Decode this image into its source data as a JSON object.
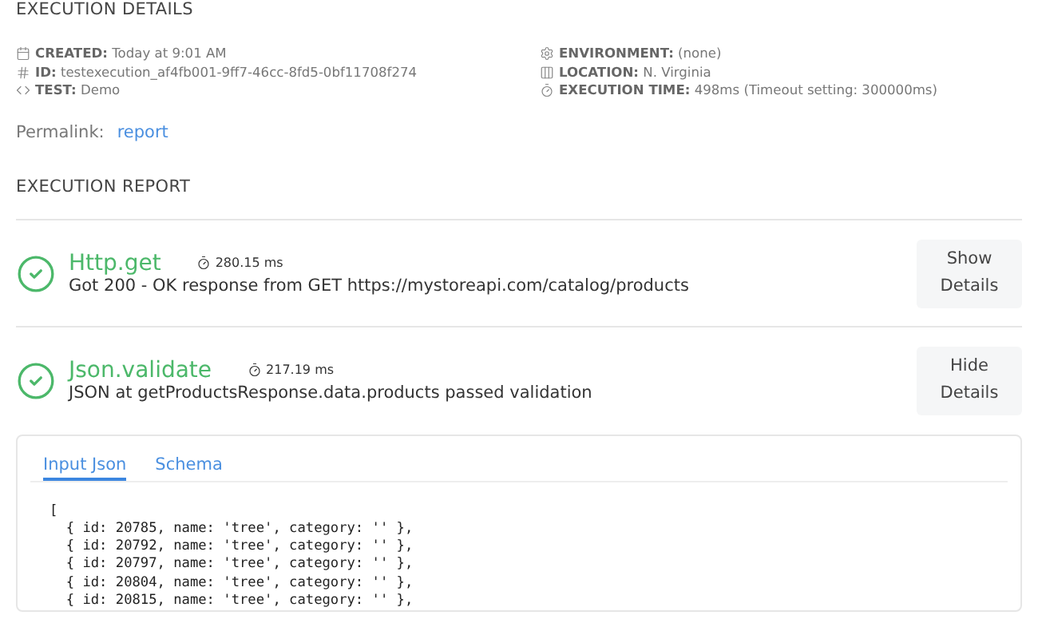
{
  "details": {
    "heading": "EXECUTION DETAILS",
    "left": [
      {
        "kind": "calendar",
        "label": "CREATED:",
        "value": "Today at 9:01 AM"
      },
      {
        "kind": "hash",
        "label": "ID:",
        "value": "testexecution_af4fb001-9ff7-46cc-8fd5-0bf11708f274"
      },
      {
        "kind": "code",
        "label": "TEST:",
        "value": "Demo"
      }
    ],
    "right": [
      {
        "kind": "gear",
        "label": "ENVIRONMENT:",
        "value": "(none)"
      },
      {
        "kind": "columns",
        "label": "LOCATION:",
        "value": "N. Virginia"
      },
      {
        "kind": "timer",
        "label": "EXECUTION TIME:",
        "value": "498ms (Timeout setting: 300000ms)"
      }
    ],
    "permalink_label": "Permalink:",
    "permalink": "report"
  },
  "report": {
    "heading": "EXECUTION REPORT",
    "steps": [
      {
        "name": "Http.get",
        "duration": "280.15 ms",
        "message": "Got 200 - OK response from GET https://mystoreapi.com/catalog/products",
        "button": [
          "Show",
          "Details"
        ]
      },
      {
        "name": "Json.validate",
        "duration": "217.19 ms",
        "message": "JSON at getProductsResponse.data.products passed validation",
        "button": [
          "Hide",
          "Details"
        ],
        "tabs": [
          {
            "label": "Input Json",
            "selected": true
          },
          {
            "label": "Schema",
            "selected": false
          }
        ],
        "code": [
          "[",
          "  { id: 20785, name: 'tree', category: '' },",
          "  { id: 20792, name: 'tree', category: '' },",
          "  { id: 20797, name: 'tree', category: '' },",
          "  { id: 20804, name: 'tree', category: '' },",
          "  { id: 20815, name: 'tree', category: '' },"
        ]
      }
    ]
  }
}
